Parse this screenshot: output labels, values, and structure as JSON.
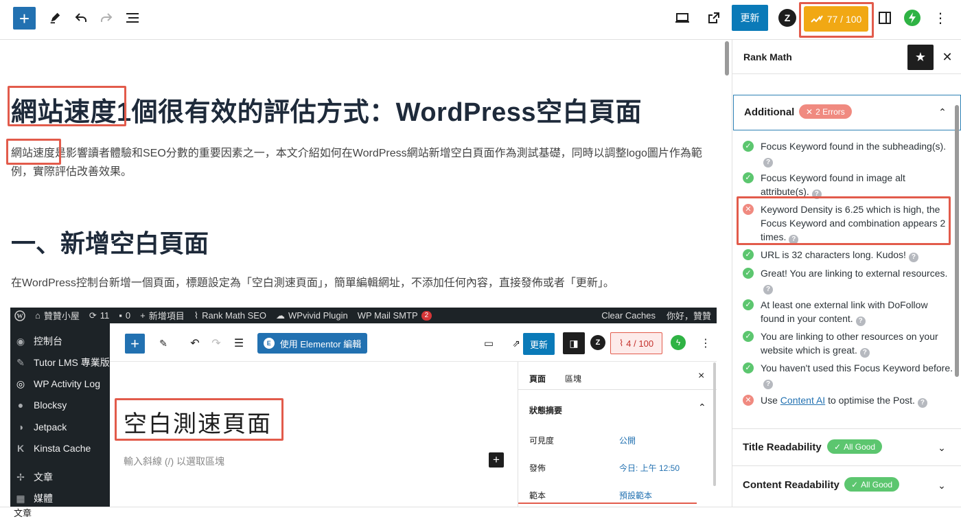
{
  "toolbar": {
    "update_label": "更新",
    "score_label": "77 / 100"
  },
  "post": {
    "title": "網站速度1個很有效的評估方式：WordPress空白頁面",
    "intro": "網站速度是影響讀者體驗和SEO分數的重要因素之一，本文介紹如何在WordPress網站新增空白頁面作為測試基礎，同時以調整logo圖片作為範例，實際評估改善效果。",
    "heading2": "一、新增空白頁面",
    "para2": "在WordPress控制台新增一個頁面，標題設定為「空白測速頁面」，簡單編輯網址，不添加任何內容，直接發佈或者「更新」。"
  },
  "screenshot": {
    "adminbar": {
      "site": "贊贊小屋",
      "updates": "11",
      "comments": "0",
      "new_item": "新增項目",
      "rankmath": "Rank Math SEO",
      "wpvivid": "WPvivid Plugin",
      "smtp": "WP Mail SMTP",
      "smtp_count": "2",
      "clear": "Clear Caches",
      "greeting": "你好，贊贊"
    },
    "menu": [
      "控制台",
      "Tutor LMS 專業版",
      "WP Activity Log",
      "Blocksy",
      "Jetpack",
      "Kinsta Cache",
      "文章",
      "媒體"
    ],
    "elementor_label": "使用 Elementor 編輯",
    "update_label": "更新",
    "score_label": "4 / 100",
    "page_title": "空白測速頁面",
    "placeholder": "輸入斜線 (/) 以選取區塊",
    "panel": {
      "tab_page": "頁面",
      "tab_block": "區塊",
      "section": "狀態摘要",
      "rows": [
        {
          "label": "可見度",
          "value": "公開"
        },
        {
          "label": "發佈",
          "value": "今日: 上午 12:50"
        },
        {
          "label": "範本",
          "value": "預設範本"
        }
      ]
    }
  },
  "statusbar": {
    "label": "文章"
  },
  "sidebar": {
    "title": "Rank Math",
    "additional": {
      "title": "Additional",
      "badge": "2 Errors"
    },
    "checks": [
      {
        "status": "ok",
        "text": "Focus Keyword found in the subheading(s)."
      },
      {
        "status": "ok",
        "text": "Focus Keyword found in image alt attribute(s)."
      },
      {
        "status": "bad",
        "text": "Keyword Density is 6.25 which is high, the Focus Keyword and combination appears 2 times."
      },
      {
        "status": "ok",
        "text": "URL is 32 characters long. Kudos!"
      },
      {
        "status": "ok",
        "text": "Great! You are linking to external resources."
      },
      {
        "status": "ok",
        "text": "At least one external link with DoFollow found in your content."
      },
      {
        "status": "ok",
        "text": "You are linking to other resources on your website which is great."
      },
      {
        "status": "ok",
        "text": "You haven't used this Focus Keyword before."
      }
    ],
    "last_check": {
      "prefix": "Use ",
      "link": "Content AI",
      "suffix": " to optimise the Post."
    },
    "title_readability": {
      "title": "Title Readability",
      "badge": "All Good"
    },
    "content_readability": {
      "title": "Content Readability",
      "badge": "All Good"
    }
  },
  "colors": {
    "accent": "#2271b1",
    "score_bg": "#f1a814",
    "annotation": "#e25b4b",
    "ok": "#5cc66f",
    "error": "#f08a80"
  }
}
